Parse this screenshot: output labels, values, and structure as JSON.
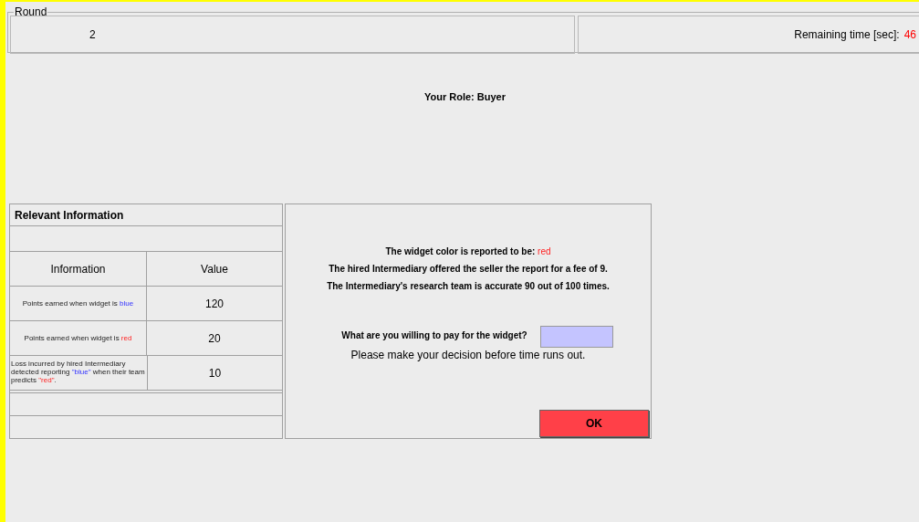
{
  "round": {
    "legend": "Round",
    "value": "2",
    "remaining_label": "Remaining time [sec]:",
    "remaining_value": "46"
  },
  "role": "Your Role: Buyer",
  "info_table": {
    "title": "Relevant Information",
    "columns": [
      "Information",
      "Value"
    ],
    "rows": [
      {
        "kind": "normal",
        "label": [
          {
            "text": "Points earned when widget is ",
            "kind": "plain"
          },
          {
            "text": "blue",
            "kind": "blue"
          }
        ],
        "value": "120"
      },
      {
        "kind": "normal",
        "label": [
          {
            "text": "Points earned when widget is ",
            "kind": "plain"
          },
          {
            "text": "red",
            "kind": "red"
          }
        ],
        "value": "20"
      },
      {
        "kind": "small",
        "label": [
          {
            "text": "Loss incurred by hired Intermediary detected reporting ",
            "kind": "plain"
          },
          {
            "text": "\"blue\"",
            "kind": "blue"
          },
          {
            "text": " when their team predicts ",
            "kind": "plain"
          },
          {
            "text": "\"red\"",
            "kind": "red"
          },
          {
            "text": ".",
            "kind": "plain"
          }
        ],
        "value": "10"
      }
    ]
  },
  "decision": {
    "report": [
      {
        "text": "The widget color is reported to be: ",
        "kind": "plain"
      },
      {
        "text": "red",
        "kind": "red"
      }
    ],
    "lines": [
      "The hired Intermediary offered the seller the report for a fee of 9.",
      "The Intermediary's research team is accurate 90 out of 100 times."
    ],
    "question": "What are you willing to pay for the widget?",
    "reminder": "Please make your decision before time runs out.",
    "button": "OK"
  }
}
